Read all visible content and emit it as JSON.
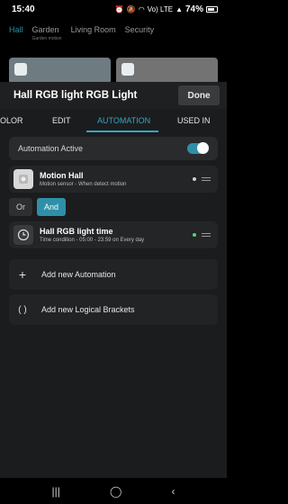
{
  "status_bar": {
    "time": "15:40",
    "battery": "74%",
    "network": "Vo) LTE"
  },
  "background": {
    "tabs": [
      {
        "label": "Hall",
        "sub": ""
      },
      {
        "label": "Garden",
        "sub": "Garden motion"
      },
      {
        "label": "Living Room",
        "sub": ""
      },
      {
        "label": "Security",
        "sub": ""
      }
    ]
  },
  "sheet": {
    "title": "Hall RGB light RGB Light",
    "done_label": "Done",
    "tabs": [
      "OLOR",
      "EDIT",
      "AUTOMATION",
      "USED IN"
    ],
    "active_tab": "AUTOMATION",
    "automation_active_label": "Automation Active",
    "automation_active": true,
    "items": [
      {
        "title": "Motion Hall",
        "subtitle": "Motion sensor - When detect motion",
        "icon": "motion-sensor-icon",
        "status": "inactive"
      },
      {
        "title": "Hall RGB light time",
        "subtitle": "Time condition - 05:00 - 23:59 on Every day",
        "icon": "clock-icon",
        "status": "active"
      }
    ],
    "logic": {
      "or_label": "Or",
      "and_label": "And",
      "selected": "And"
    },
    "add_automation_label": "Add new Automation",
    "add_brackets_label": "Add new Logical Brackets",
    "colors": {
      "accent": "#2f8fa8",
      "active_dot": "#5dd06a"
    }
  }
}
